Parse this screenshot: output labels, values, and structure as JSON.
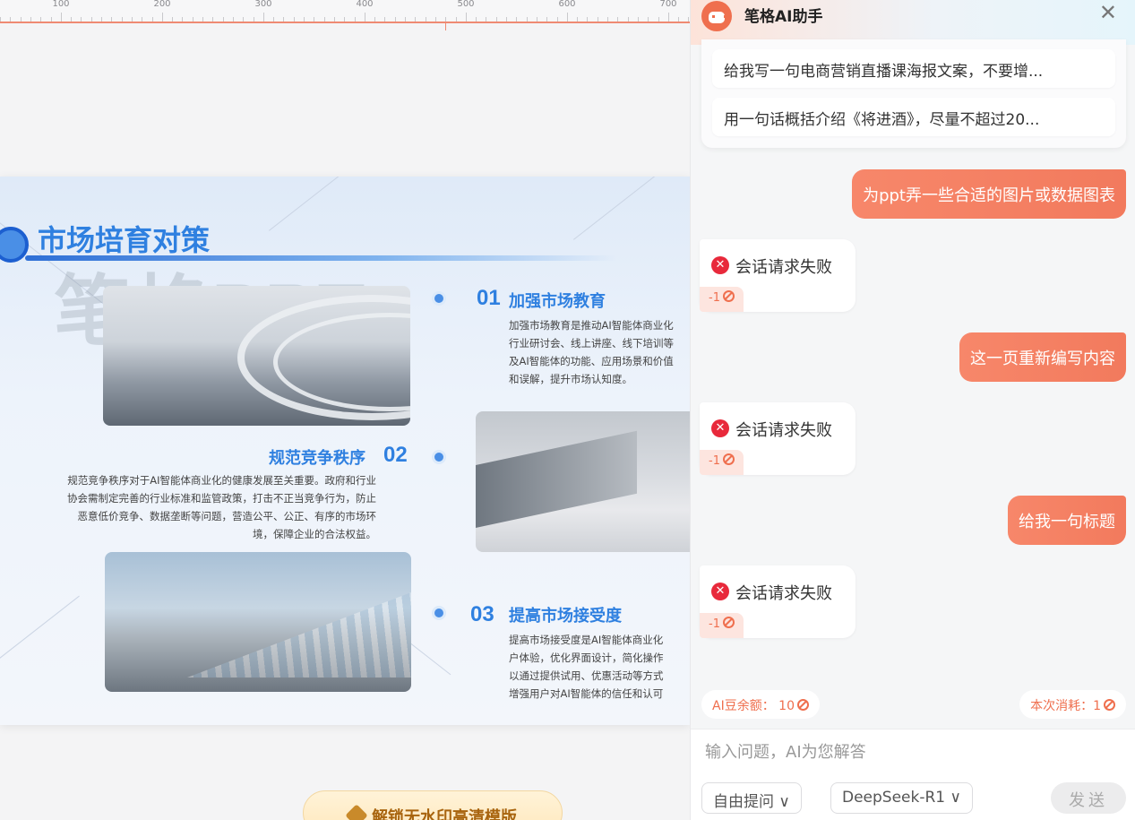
{
  "ruler": {
    "labels": [
      "100",
      "200",
      "300",
      "400",
      "500",
      "600",
      "700"
    ]
  },
  "slide": {
    "watermark": "笔格PPT",
    "title": "市场培育对策",
    "sections": [
      {
        "num": "01",
        "title": "加强市场教育",
        "body": [
          "加强市场教育是推动AI智能体商业化",
          "行业研讨会、线上讲座、线下培训等",
          "及AI智能体的功能、应用场景和价值",
          "和误解，提升市场认知度。"
        ]
      },
      {
        "num": "02",
        "title": "规范竞争秩序",
        "body": [
          "规范竞争秩序对于AI智能体商业化的健康发展至关重要。政府和行业",
          "协会需制定完善的行业标准和监管政策，打击不正当竞争行为，防止",
          "恶意低价竞争、数据垄断等问题，营造公平、公正、有序的市场环",
          "境，保障企业的合法权益。"
        ]
      },
      {
        "num": "03",
        "title": "提高市场接受度",
        "body": [
          "提高市场接受度是AI智能体商业化",
          "户体验，优化界面设计，简化操作",
          "以通过提供试用、优惠活动等方式",
          "增强用户对AI智能体的信任和认可"
        ]
      }
    ],
    "unlock_label": "解锁无水印高清模版"
  },
  "panel": {
    "title": "笔格AI助手",
    "suggestions": [
      "给我写一句电商营销直播课海报文案，不要增...",
      "用一句话概括介绍《将进酒》，尽量不超过20..."
    ],
    "messages": [
      {
        "user": "为ppt弄一些合适的图片或数据图表",
        "error": "会话请求失败",
        "cost": "-1"
      },
      {
        "user": "这一页重新编写内容",
        "error": "会话请求失败",
        "cost": "-1"
      },
      {
        "user": "给我一句标题",
        "error": "会话请求失败",
        "cost": "-1"
      }
    ],
    "balance_label": "AI豆余额：",
    "balance_value": "10",
    "cost_label": "本次消耗：",
    "cost_value": "1",
    "input_placeholder": "输入问题，AI为您解答",
    "mode_label": "自由提问 ∨",
    "model_label": "DeepSeek-R1 ∨",
    "send_label": "发送"
  },
  "colors": {
    "accent": "#ef6f4e",
    "slide_blue": "#2f80e0",
    "error_red": "#e8293b"
  }
}
